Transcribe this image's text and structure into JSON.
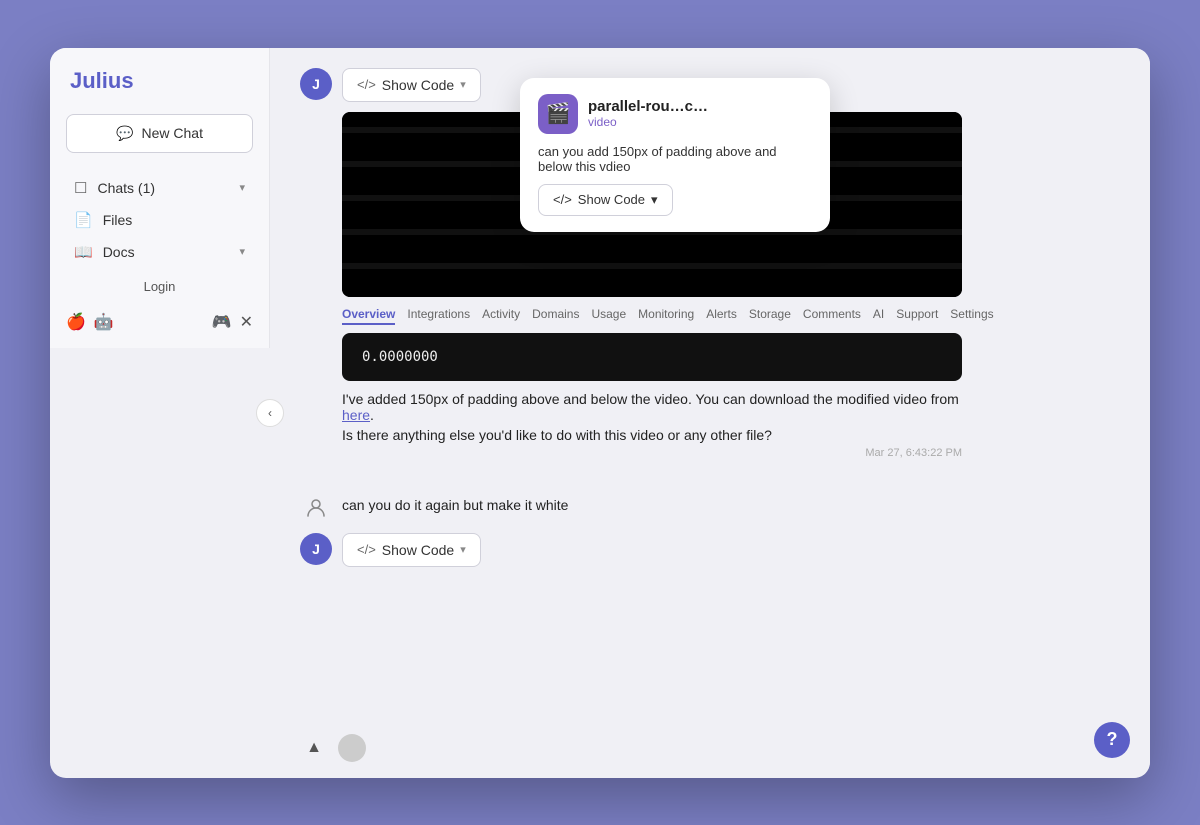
{
  "sidebar": {
    "logo": "Julius",
    "new_chat_label": "New Chat",
    "nav_items": [
      {
        "id": "chats",
        "label": "Chats",
        "badge": "(1)",
        "has_chevron": true,
        "icon": "💬"
      },
      {
        "id": "files",
        "label": "Files",
        "has_chevron": false,
        "icon": "📄"
      },
      {
        "id": "docs",
        "label": "Docs",
        "has_chevron": true,
        "icon": "📖"
      }
    ],
    "login_label": "Login",
    "footer_icons": [
      "🍎",
      "🤖",
      "🎮",
      "✕"
    ]
  },
  "tooltip": {
    "app_name": "parallel-rou…c…",
    "app_type": "video",
    "message": "can you add 150px of padding above and below this vdieo",
    "show_code_label": "Show Code",
    "show_code_chevron": "▾"
  },
  "chat": {
    "messages": [
      {
        "type": "user_system",
        "text": "can you add 150px of padding above and below this vdieo",
        "icon": "👤"
      },
      {
        "type": "ai_with_code",
        "avatar": "J",
        "show_code_label": "Show Code",
        "show_code_chevron": "▾",
        "has_video": true,
        "tabs": [
          "Overview",
          "Integrations",
          "Activity",
          "Domains",
          "Usage",
          "Monitoring",
          "Alerts",
          "Storage",
          "Comments",
          "AI",
          "Support",
          "Settings"
        ],
        "active_tab": "Overview",
        "code_output": "0.0000000",
        "text_line1": "I've added 150px of padding above and below the video. You can download the modified video from",
        "link": "here",
        "text_line2": "Is there anything else you'd like to do with this video or any other file?",
        "timestamp": "Mar 27, 6:43:22 PM"
      },
      {
        "type": "user",
        "icon": "👤",
        "text": "can you do it again but make it white"
      },
      {
        "type": "ai_code_only",
        "avatar": "J",
        "show_code_label": "Show Code",
        "show_code_chevron": "▾"
      }
    ]
  },
  "upload_area": {
    "upload_icon": "▲"
  },
  "help": {
    "label": "?"
  }
}
